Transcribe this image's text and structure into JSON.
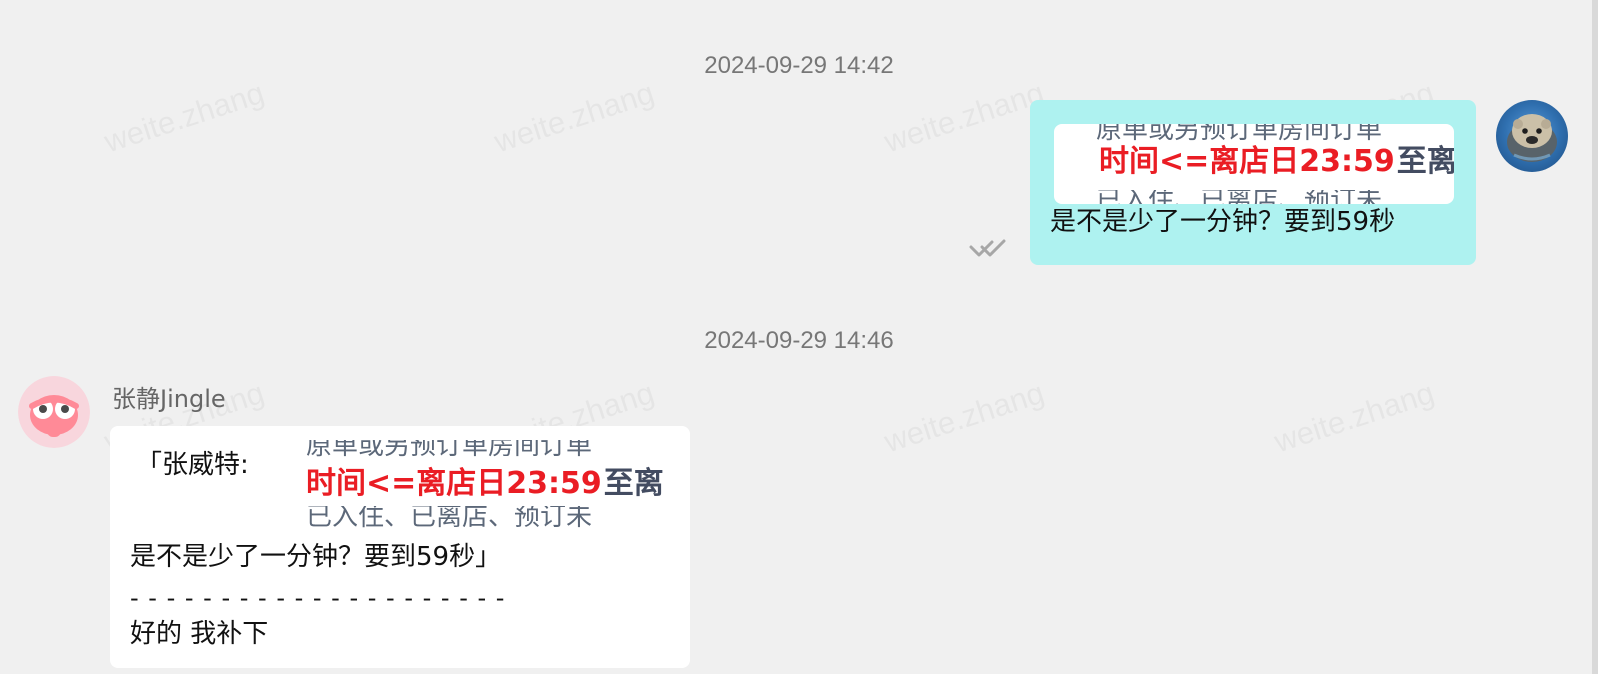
{
  "watermark_text": "weite.zhang",
  "timeline": [
    {
      "timestamp": "2024-09-29 14:42"
    },
    {
      "timestamp": "2024-09-29 14:46"
    }
  ],
  "messages": {
    "outgoing": {
      "quoted_image": {
        "top_blur": "原单或另预订单房间订单",
        "main_line": "时间<=离店日23:59",
        "tail": "至离",
        "bottom_blur": "已入住、已离店、预订未"
      },
      "text": "是不是少了一分钟？要到59秒",
      "status_icon": "double-check-icon",
      "avatar_icon": "otter-avatar"
    },
    "incoming": {
      "sender_name": "张静Jingle",
      "avatar_icon": "pink-bird-avatar",
      "quote_prefix": "「张威特:",
      "quoted_image": {
        "top_blur": "原单或另预订单房间订单",
        "main_line": "时间<=离店日23:59",
        "tail": "至离",
        "bottom_blur": "已入住、已离店、预订未"
      },
      "quoted_text": "是不是少了一分钟？要到59秒」",
      "divider": "- - - - - - - - - - - - - - - - - - - - -",
      "reply": "好的 我补下"
    }
  },
  "colors": {
    "background": "#f0f0f0",
    "outgoing_bubble": "#aef2f0",
    "incoming_bubble": "#ffffff",
    "highlight_red": "#ea1d24",
    "timestamp": "#777777"
  }
}
